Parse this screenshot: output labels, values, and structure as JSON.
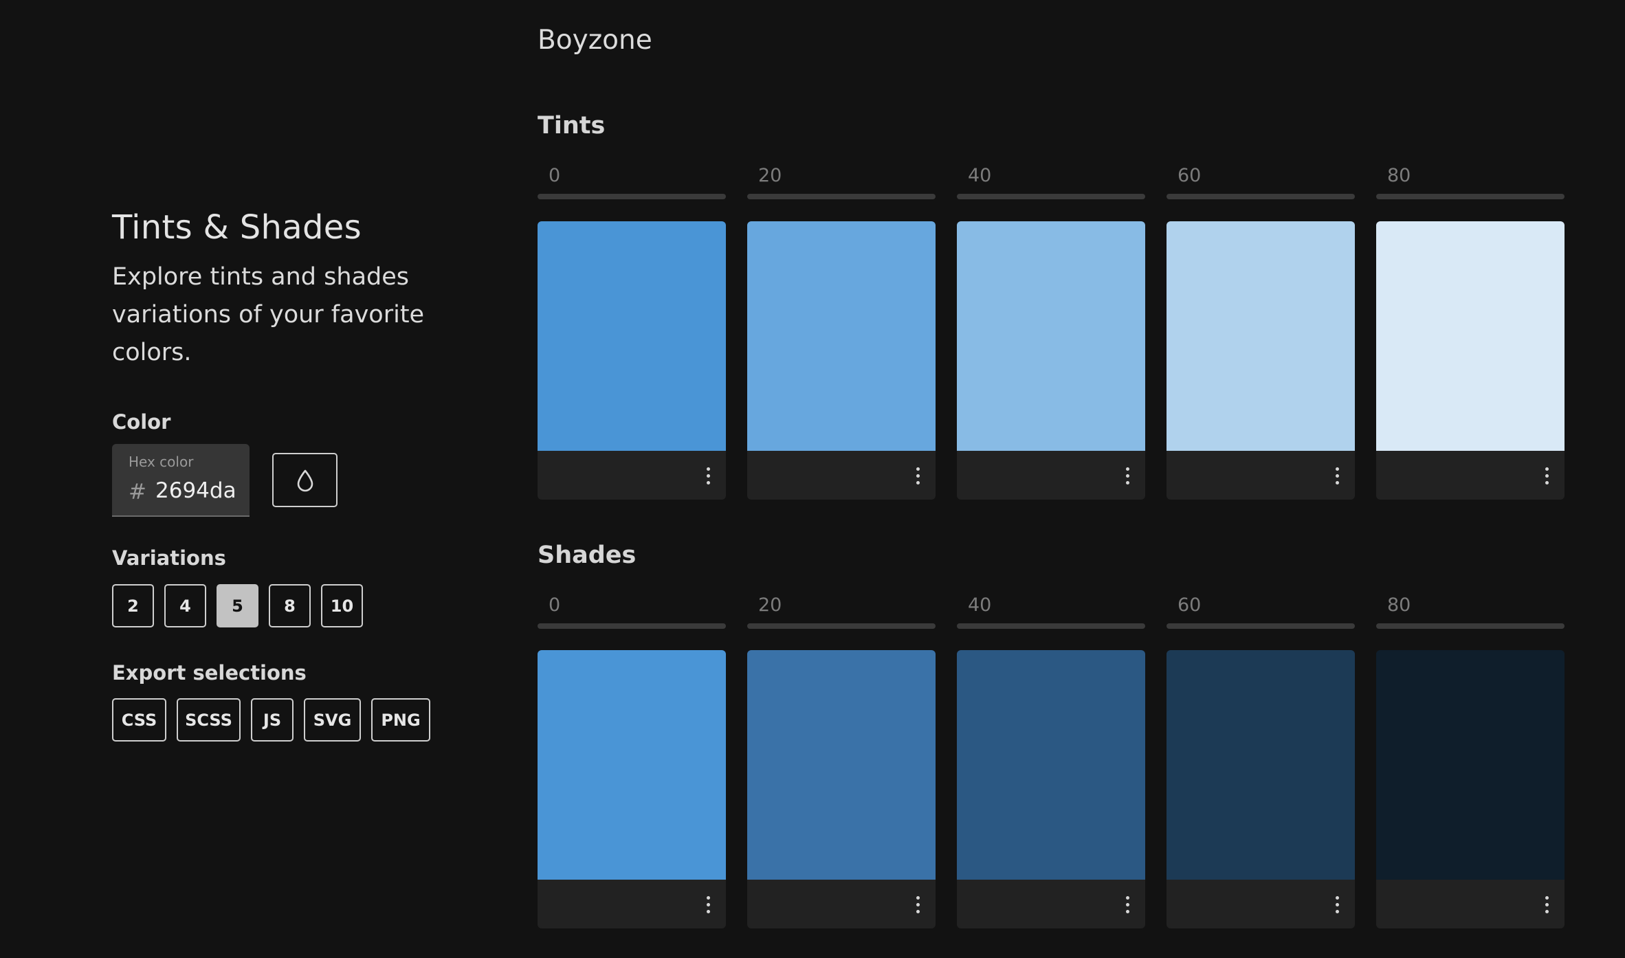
{
  "sidebar": {
    "title": "Tints & Shades",
    "description": "Explore tints and shades variations of your favorite colors.",
    "color_label": "Color",
    "hex_field_label": "Hex color",
    "hex_prefix": "#",
    "hex_value": "2694da",
    "variations_label": "Variations",
    "variations": [
      "2",
      "4",
      "5",
      "8",
      "10"
    ],
    "selected_variation": "5",
    "export_label": "Export selections",
    "export_formats": [
      "CSS",
      "SCSS",
      "JS",
      "SVG",
      "PNG"
    ]
  },
  "palette_name": "Boyzone",
  "tints": {
    "title": "Tints",
    "steps": [
      "0",
      "20",
      "40",
      "60",
      "80"
    ],
    "colors": [
      "#4a95d6",
      "#67a7de",
      "#88bbe5",
      "#b0d2ed",
      "#d9e9f6"
    ]
  },
  "shades": {
    "title": "Shades",
    "steps": [
      "0",
      "20",
      "40",
      "60",
      "80"
    ],
    "colors": [
      "#4a95d6",
      "#3a72a8",
      "#2b5883",
      "#1c3a55",
      "#0f1e2b"
    ]
  },
  "icons": {
    "color_picker": "droplet-icon",
    "swatch_menu": "more-vertical-icon"
  }
}
